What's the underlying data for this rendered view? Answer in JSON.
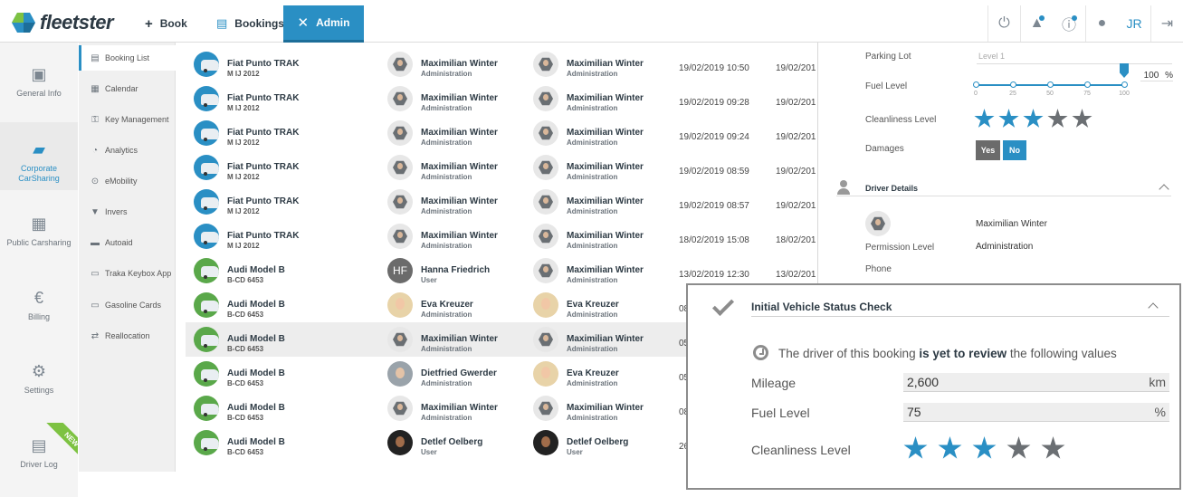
{
  "app": {
    "brand": "fleetster"
  },
  "nav": {
    "book": "Book",
    "bookings": "Bookings",
    "admin": "Admin"
  },
  "user": {
    "initials": "JR"
  },
  "colors": {
    "accent": "#2a8fc4",
    "new_ribbon": "#7dc242"
  },
  "sidebar": [
    {
      "label": "General Info",
      "icon": "clipboard-icon"
    },
    {
      "label": "Corporate CarSharing",
      "icon": "car-share-icon"
    },
    {
      "label": "Public Carsharing",
      "icon": "bus-icon"
    },
    {
      "label": "Billing",
      "icon": "euro-icon"
    },
    {
      "label": "Settings",
      "icon": "gear-icon"
    },
    {
      "label": "Driver Log",
      "icon": "logbook-icon",
      "badge": "NEW"
    }
  ],
  "submenu": [
    {
      "label": "Booking List",
      "icon": "list-icon"
    },
    {
      "label": "Calendar",
      "icon": "calendar-icon"
    },
    {
      "label": "Key Management",
      "icon": "key-icon"
    },
    {
      "label": "Analytics",
      "icon": "analytics-icon"
    },
    {
      "label": "eMobility",
      "icon": "plug-icon"
    },
    {
      "label": "Invers",
      "icon": "invers-icon"
    },
    {
      "label": "Autoaid",
      "icon": "car-icon"
    },
    {
      "label": "Traka Keybox App",
      "icon": "keybox-icon"
    },
    {
      "label": "Gasoline Cards",
      "icon": "card-icon"
    },
    {
      "label": "Reallocation",
      "icon": "reallocate-icon"
    }
  ],
  "bookings": [
    {
      "car": "Fiat Punto TRAK",
      "plate": "M IJ 2012",
      "driver": "Maximilian Winter",
      "driver_role": "Administration",
      "booker": "Maximilian Winter",
      "booker_role": "Administration",
      "start": "19/02/2019 10:50",
      "end": "19/02/201"
    },
    {
      "car": "Fiat Punto TRAK",
      "plate": "M IJ 2012",
      "driver": "Maximilian Winter",
      "driver_role": "Administration",
      "booker": "Maximilian Winter",
      "booker_role": "Administration",
      "start": "19/02/2019 09:28",
      "end": "19/02/201"
    },
    {
      "car": "Fiat Punto TRAK",
      "plate": "M IJ 2012",
      "driver": "Maximilian Winter",
      "driver_role": "Administration",
      "booker": "Maximilian Winter",
      "booker_role": "Administration",
      "start": "19/02/2019 09:24",
      "end": "19/02/201"
    },
    {
      "car": "Fiat Punto TRAK",
      "plate": "M IJ 2012",
      "driver": "Maximilian Winter",
      "driver_role": "Administration",
      "booker": "Maximilian Winter",
      "booker_role": "Administration",
      "start": "19/02/2019 08:59",
      "end": "19/02/201"
    },
    {
      "car": "Fiat Punto TRAK",
      "plate": "M IJ 2012",
      "driver": "Maximilian Winter",
      "driver_role": "Administration",
      "booker": "Maximilian Winter",
      "booker_role": "Administration",
      "start": "19/02/2019 08:57",
      "end": "19/02/201"
    },
    {
      "car": "Fiat Punto TRAK",
      "plate": "M IJ 2012",
      "driver": "Maximilian Winter",
      "driver_role": "Administration",
      "booker": "Maximilian Winter",
      "booker_role": "Administration",
      "start": "18/02/2019 15:08",
      "end": "18/02/201"
    },
    {
      "car": "Audi Model B",
      "plate": "B-CD 6453",
      "driver": "Hanna Friedrich",
      "driver_role": "User",
      "driver_initials": "HF",
      "booker": "Maximilian Winter",
      "booker_role": "Administration",
      "start": "13/02/2019 12:30",
      "end": "13/02/201"
    },
    {
      "car": "Audi Model B",
      "plate": "B-CD 6453",
      "driver": "Eva Kreuzer",
      "driver_role": "Administration",
      "booker": "Eva Kreuzer",
      "booker_role": "Administration",
      "start": "08",
      "end": ""
    },
    {
      "car": "Audi Model B",
      "plate": "B-CD 6453",
      "driver": "Maximilian Winter",
      "driver_role": "Administration",
      "booker": "Maximilian Winter",
      "booker_role": "Administration",
      "start": "05",
      "end": ""
    },
    {
      "car": "Audi Model B",
      "plate": "B-CD 6453",
      "driver": "Dietfried Gwerder",
      "driver_role": "Administration",
      "booker": "Eva Kreuzer",
      "booker_role": "Administration",
      "start": "05",
      "end": ""
    },
    {
      "car": "Audi Model B",
      "plate": "B-CD 6453",
      "driver": "Maximilian Winter",
      "driver_role": "Administration",
      "booker": "Maximilian Winter",
      "booker_role": "Administration",
      "start": "08",
      "end": ""
    },
    {
      "car": "Audi Model B",
      "plate": "B-CD 6453",
      "driver": "Detlef Oelberg",
      "driver_role": "User",
      "booker": "Detlef Oelberg",
      "booker_role": "User",
      "start": "26",
      "end": ""
    }
  ],
  "detail": {
    "parking_label": "Parking Lot",
    "parking_placeholder": "Level 1",
    "fuel_label": "Fuel Level",
    "fuel_value": "100",
    "fuel_unit": "%",
    "fuel_fraction": 1.0,
    "slider_ticks": [
      "0",
      "25",
      "50",
      "75",
      "100"
    ],
    "cleanliness_label": "Cleanliness Level",
    "cleanliness_stars": 3,
    "cleanliness_max": 5,
    "damages_label": "Damages",
    "yes": "Yes",
    "no": "No",
    "driver_section": "Driver Details",
    "driver_name": "Maximilian Winter",
    "permission_label": "Permission Level",
    "permission_value": "Administration",
    "phone_label": "Phone"
  },
  "check": {
    "title": "Initial Vehicle Status Check",
    "review_pre": "The driver of this booking",
    "review_bold": "is yet to review",
    "review_post": "the following values",
    "mileage_label": "Mileage",
    "mileage_value": "2,600",
    "mileage_unit": "km",
    "fuel_label": "Fuel Level",
    "fuel_value": "75",
    "fuel_unit": "%",
    "cleanliness_label": "Cleanliness Level",
    "cleanliness_stars": 3,
    "cleanliness_max": 5
  }
}
